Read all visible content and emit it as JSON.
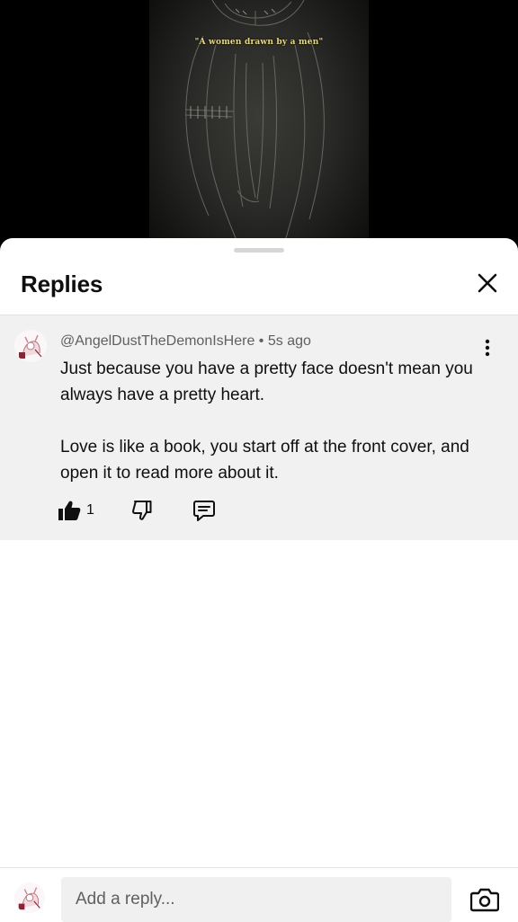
{
  "video": {
    "caption": "\"A women drawn by a men\""
  },
  "sheet": {
    "title": "Replies"
  },
  "comment": {
    "author": "@AngelDustTheDemonIsHere",
    "separator": "•",
    "time": "5s ago",
    "paragraphs": [
      "Just because you have a pretty face doesn't mean you always have a pretty heart.",
      "Love is like a book, you start off at the front cover, and open it to read more about it."
    ],
    "likes": "1"
  },
  "reply_bar": {
    "placeholder": "Add a reply..."
  },
  "icons": {
    "close": "close-icon",
    "more": "more-vertical-icon",
    "like": "thumbs-up-icon",
    "dislike": "thumbs-down-icon",
    "reply": "reply-comment-icon",
    "camera": "camera-icon"
  }
}
